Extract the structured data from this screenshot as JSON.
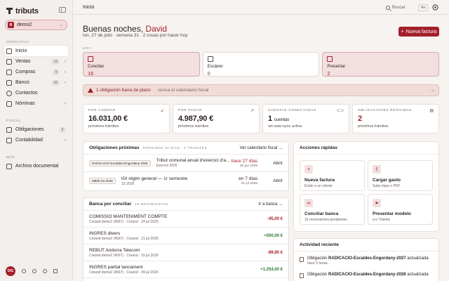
{
  "app": {
    "brand": "tributs",
    "breadcrumb": "Inicio"
  },
  "colors": {
    "accent": "#a31f2a",
    "positive": "#2e7a34",
    "tint": "#f3dfe0"
  },
  "sidebar": {
    "org": {
      "badge": "R",
      "name": "demo2"
    },
    "sections": [
      {
        "label": "OPERATIVA"
      },
      {
        "label": "FISCAL"
      },
      {
        "label": "MÁS"
      }
    ],
    "items": [
      {
        "label": "Inicio",
        "icon": "home-icon"
      },
      {
        "label": "Ventas",
        "count": "12",
        "icon": "tag-icon"
      },
      {
        "label": "Compras",
        "count": "9",
        "icon": "cart-icon"
      },
      {
        "label": "Banco",
        "count": "16",
        "icon": "bank-icon"
      },
      {
        "label": "Contactos",
        "icon": "contacts-icon"
      },
      {
        "label": "Nóminas",
        "icon": "payroll-icon"
      },
      {
        "label": "Obligaciones",
        "count": "2",
        "icon": "calendar-icon"
      },
      {
        "label": "Contabilidad",
        "icon": "ledger-icon"
      },
      {
        "label": "Archivo documental",
        "icon": "archive-icon"
      }
    ],
    "footer": {
      "avatar": "DG"
    }
  },
  "topbar": {
    "search_placeholder": "Buscar",
    "shortcut": "⌘K"
  },
  "header": {
    "greeting_prefix": "Buenas noches,",
    "greeting_name": "David",
    "subline": "lun, 27 de julio · semana 31 · 2 cosas por hacer hoy",
    "new_invoice": "Nueva factura"
  },
  "today": {
    "label": "HOY",
    "cards": [
      {
        "label": "Conciliar",
        "value": "16"
      },
      {
        "label": "Escáner",
        "value": "0"
      },
      {
        "label": "Presentar",
        "value": "2"
      }
    ]
  },
  "alert": {
    "strong": "1 obligación fuera de plazo",
    "sep": "·",
    "link": "revisa el calendario fiscal"
  },
  "metrics": [
    {
      "label": "POR COBRAR",
      "value": "16.031,00 €",
      "sub": "próximos trámites"
    },
    {
      "label": "POR PAGAR",
      "value": "4.987,90 €",
      "sub": "próximos trámites"
    },
    {
      "label": "CUENTAS CONECTADAS",
      "value": "1",
      "value_small": "cuentas",
      "sub": "sin auto-sync activa"
    },
    {
      "label": "OBLIGACIONES PRÓXIMAS",
      "value": "2",
      "sub": "próximos trámites"
    }
  ],
  "obligations": {
    "title": "Obligaciones próximas",
    "meta": "PRÓXIMOS 30 DÍAS · 2 TRÁMITES",
    "link": "Ver calendario fiscal",
    "rows": [
      {
        "tag": "RADICACIO-Escaldes-Engordany-2026",
        "title": "Tribut comunal anual d'exercici d'act...",
        "sub": "Exercici 2026",
        "due": "hace 27 días",
        "date": "30 jun 2026",
        "action": "Abrir"
      },
      {
        "tag": "M900-S1-2026",
        "title": "IGI règim general — 1r semestre",
        "sub": "1S 2026",
        "due": "en 7 días",
        "date": "31 jul 2026",
        "action": "Abrir"
      }
    ]
  },
  "bank": {
    "title": "Banca por conciliar",
    "meta": "16 MOVIMIENTOS",
    "link": "Ir a banca",
    "rows": [
      {
        "title": "COMISSIO MANTENIMENT COMPTE",
        "sub": "Creand demo2 (4567) · Creand · 24 jul 2026",
        "amount": "-45,00 €",
        "kind": "neg"
      },
      {
        "title": "INGRES divers",
        "sub": "Creand demo2 (4567) · Creand · 21 jul 2026",
        "amount": "+500,00 €",
        "kind": "pos"
      },
      {
        "title": "REBUT Andorra Telecom",
        "sub": "Creand demo2 (4567) · Creand · 15 jul 2026",
        "amount": "-89,90 €",
        "kind": "neg"
      },
      {
        "title": "INGRES partial tancament",
        "sub": "Creand demo2 (4567) · Creand · 09 jul 2026",
        "amount": "+1.254,00 €",
        "kind": "pos"
      }
    ]
  },
  "quick": {
    "title": "Acciones rápidas",
    "items": [
      {
        "title": "Nueva factura",
        "sub": "Emite a un cliente",
        "icon": "plus-icon"
      },
      {
        "title": "Cargar gasto",
        "sub": "Sube tique o PDF",
        "icon": "upload-icon"
      },
      {
        "title": "Conciliar banca",
        "sub": "16 movimientos pendientes",
        "icon": "link-icon"
      },
      {
        "title": "Presentar modelo",
        "sub": "a e-Tràmits",
        "icon": "send-icon"
      }
    ]
  },
  "activity": {
    "title": "Actividad reciente",
    "rows": [
      {
        "prefix": "Obligación",
        "bold": "RADICACIO-Escaldes-Engordany-2027",
        "suffix": "actualizada",
        "time": "hace 5 horas"
      },
      {
        "prefix": "Obligación",
        "bold": "RADICACIO-Escaldes-Engordany-2026",
        "suffix": "actualizada",
        "time": ""
      }
    ]
  }
}
